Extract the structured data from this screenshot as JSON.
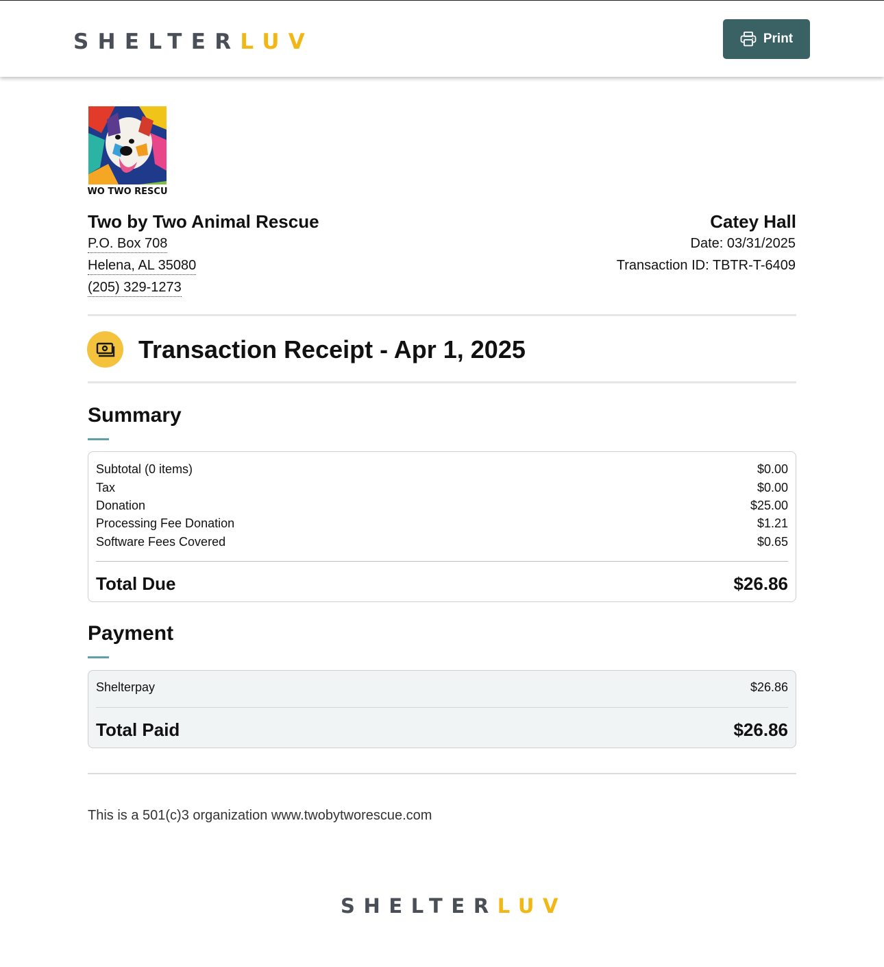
{
  "brand": {
    "part1": "SHELTER",
    "part2": "LUV"
  },
  "header": {
    "print_label": "Print"
  },
  "logo": {
    "caption": "TWO TWO RESCUE"
  },
  "org": {
    "name": "Two by Two Animal Rescue",
    "address1": "P.O. Box 708",
    "address2": "Helena, AL 35080",
    "phone": "(205) 329-1273"
  },
  "customer": {
    "name": "Catey Hall",
    "date": "Date: 03/31/2025",
    "transaction_id": "Transaction ID: TBTR-T-6409"
  },
  "receipt": {
    "title": "Transaction Receipt - Apr 1, 2025"
  },
  "summary": {
    "title": "Summary",
    "rows": [
      {
        "label": "Subtotal (0 items)",
        "value": "$0.00"
      },
      {
        "label": "Tax",
        "value": "$0.00"
      },
      {
        "label": "Donation",
        "value": "$25.00"
      },
      {
        "label": "Processing Fee Donation",
        "value": "$1.21"
      },
      {
        "label": "Software Fees Covered",
        "value": "$0.65"
      }
    ],
    "total_label": "Total Due",
    "total_value": "$26.86"
  },
  "payment": {
    "title": "Payment",
    "rows": [
      {
        "label": "Shelterpay",
        "value": "$26.86"
      }
    ],
    "total_label": "Total Paid",
    "total_value": "$26.86"
  },
  "footnote": "This is a 501(c)3 organization www.twobytworescue.com",
  "colors": {
    "accent": "#3a6264",
    "brand_yellow": "#f1b716",
    "brand_gray": "#4a4f57",
    "icon_bg": "#f4c23c",
    "section_accent": "#5f9fa8"
  },
  "icons": {
    "print": "printer-icon",
    "receipt": "money-icon"
  }
}
